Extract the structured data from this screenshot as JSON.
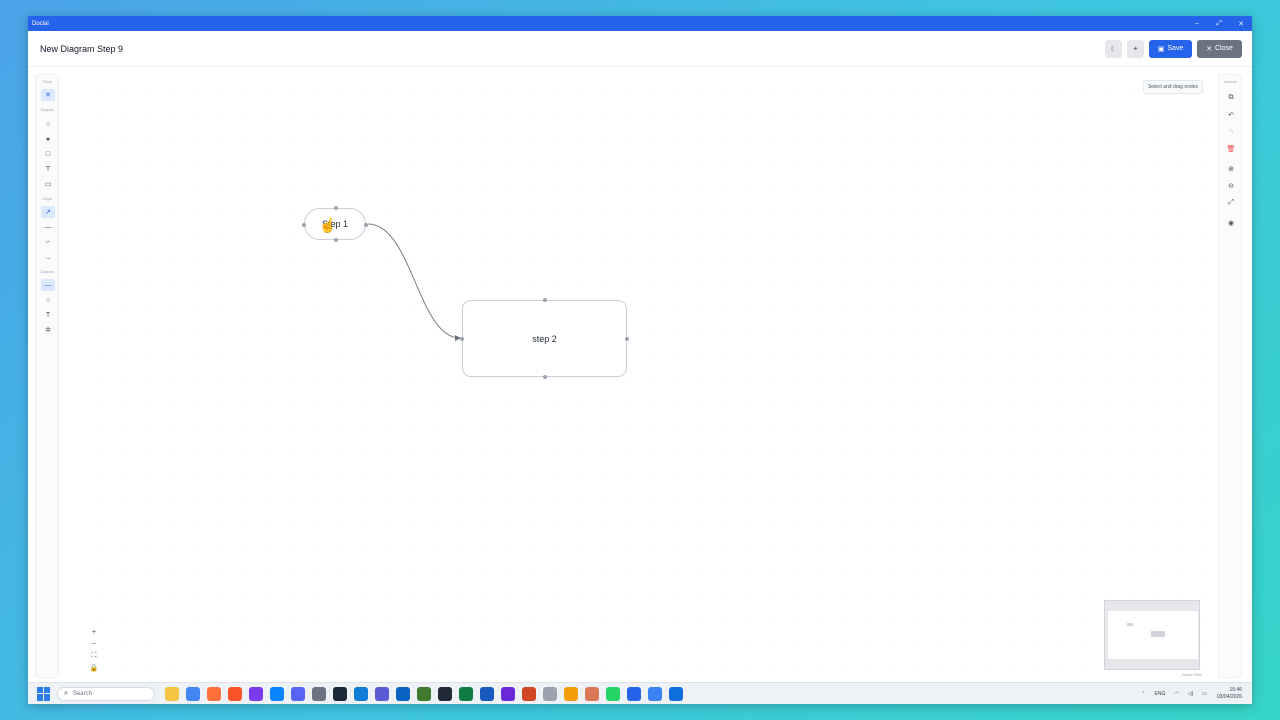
{
  "window": {
    "title": "Doclai",
    "controls": [
      "–",
      "⤢",
      "✕"
    ]
  },
  "header": {
    "title": "New Diagram Step 9",
    "theme_icon": "moon-icon",
    "magic_icon": "sparkle-icon",
    "save_label": "Save",
    "close_label": "Close"
  },
  "left_toolbar": {
    "sections": [
      {
        "label": "Tools",
        "items": [
          {
            "icon": "pointer-icon",
            "glyph": "✕",
            "active": true
          }
        ]
      },
      {
        "label": "Shapes",
        "items": [
          {
            "icon": "circle-outline-icon",
            "glyph": "○"
          },
          {
            "icon": "circle-filled-icon",
            "glyph": "●"
          },
          {
            "icon": "square-icon",
            "glyph": "□"
          },
          {
            "icon": "text-icon",
            "glyph": "T"
          },
          {
            "icon": "frame-icon",
            "glyph": "▭"
          }
        ]
      },
      {
        "label": "Edge",
        "items": [
          {
            "icon": "curved-edge-icon",
            "glyph": "↗",
            "active": true
          },
          {
            "icon": "straight-edge-icon",
            "glyph": "—"
          },
          {
            "icon": "step-edge-icon",
            "glyph": "⌐"
          },
          {
            "icon": "arrow-edge-icon",
            "glyph": "→"
          }
        ]
      },
      {
        "label": "Custom",
        "items": [
          {
            "icon": "line-icon",
            "glyph": "—",
            "active": true
          },
          {
            "icon": "circle-custom-icon",
            "glyph": "○"
          },
          {
            "icon": "text-custom-icon",
            "glyph": "T"
          },
          {
            "icon": "settings-icon",
            "glyph": "✲"
          }
        ]
      }
    ]
  },
  "right_toolbar": {
    "label": "Actions",
    "items": [
      {
        "icon": "copy-icon",
        "glyph": "⧉"
      },
      {
        "icon": "undo-icon",
        "glyph": "↶"
      },
      {
        "icon": "redo-icon",
        "glyph": "↷",
        "disabled": true
      },
      {
        "icon": "trash-icon",
        "glyph": "🗑",
        "danger": true
      },
      {
        "icon": "zoom-in-icon",
        "glyph": "⊕"
      },
      {
        "icon": "zoom-out-icon",
        "glyph": "⊖"
      },
      {
        "icon": "fit-view-icon",
        "glyph": "⤢"
      },
      {
        "icon": "palette-icon",
        "glyph": "◉"
      }
    ]
  },
  "canvas": {
    "hint": "Select and drag nodes",
    "nodes": [
      {
        "id": "step1",
        "label": "Step 1"
      },
      {
        "id": "step2",
        "label": "step 2"
      }
    ],
    "zoom_controls": [
      "+",
      "−",
      "⛶",
      "🔒"
    ],
    "attribution": "React Flow"
  },
  "taskbar": {
    "search_placeholder": "Search",
    "apps": [
      {
        "icon": "folder-icon",
        "color": "#f5c342"
      },
      {
        "icon": "chrome-icon",
        "color": "#4285f4"
      },
      {
        "icon": "firefox-icon",
        "color": "#ff7139"
      },
      {
        "icon": "brave-icon",
        "color": "#fb542b"
      },
      {
        "icon": "obsidian-icon",
        "color": "#7c3aed"
      },
      {
        "icon": "vscode-icon",
        "color": "#0a84ff"
      },
      {
        "icon": "discord-icon",
        "color": "#5865f2"
      },
      {
        "icon": "calculator-icon",
        "color": "#6b7280"
      },
      {
        "icon": "steam-icon",
        "color": "#1b2838"
      },
      {
        "icon": "edge-icon",
        "color": "#0f7cd6"
      },
      {
        "icon": "notion-icon",
        "color": "#5b5bd6"
      },
      {
        "icon": "outlook-icon",
        "color": "#0a64c2"
      },
      {
        "icon": "minecraft-icon",
        "color": "#3f7b2c"
      },
      {
        "icon": "terminal-icon",
        "color": "#1f2937"
      },
      {
        "icon": "excel-icon",
        "color": "#107c41"
      },
      {
        "icon": "word-icon",
        "color": "#185abd"
      },
      {
        "icon": "obs-icon",
        "color": "#6d28d9"
      },
      {
        "icon": "powerpoint-icon",
        "color": "#d24726"
      },
      {
        "icon": "chatgpt-icon",
        "color": "#9ca3af"
      },
      {
        "icon": "cloud-icon",
        "color": "#f59e0b"
      },
      {
        "icon": "claude-icon",
        "color": "#d97757"
      },
      {
        "icon": "whatsapp-icon",
        "color": "#25d366"
      },
      {
        "icon": "doclai-icon",
        "color": "#2563eb"
      },
      {
        "icon": "pen-icon",
        "color": "#3b82f6"
      },
      {
        "icon": "teamviewer-icon",
        "color": "#0e6fdb"
      }
    ],
    "tray": {
      "lang": "ENG",
      "time": "15:46",
      "date": "03/04/2026"
    }
  }
}
